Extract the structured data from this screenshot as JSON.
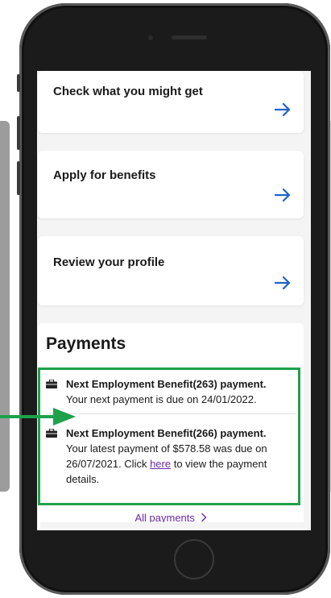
{
  "cards": [
    {
      "title": "Check what you might get"
    },
    {
      "title": "Apply for benefits"
    },
    {
      "title": "Review your profile"
    }
  ],
  "payments": {
    "title": "Payments",
    "items": [
      {
        "heading": "Next Employment Benefit(263) payment.",
        "text": "Your next payment is due on 24/01/2022."
      },
      {
        "heading": "Next Employment Benefit(266) payment.",
        "text_before": "Your latest payment of $578.58 was due on 26/07/2021. Click ",
        "link": "here",
        "text_after": " to view the payment details."
      }
    ],
    "all_payments": "All payments"
  },
  "colors": {
    "arrow": "#1e63c8",
    "highlight": "#1fa14b",
    "link": "#6a2aa6"
  }
}
